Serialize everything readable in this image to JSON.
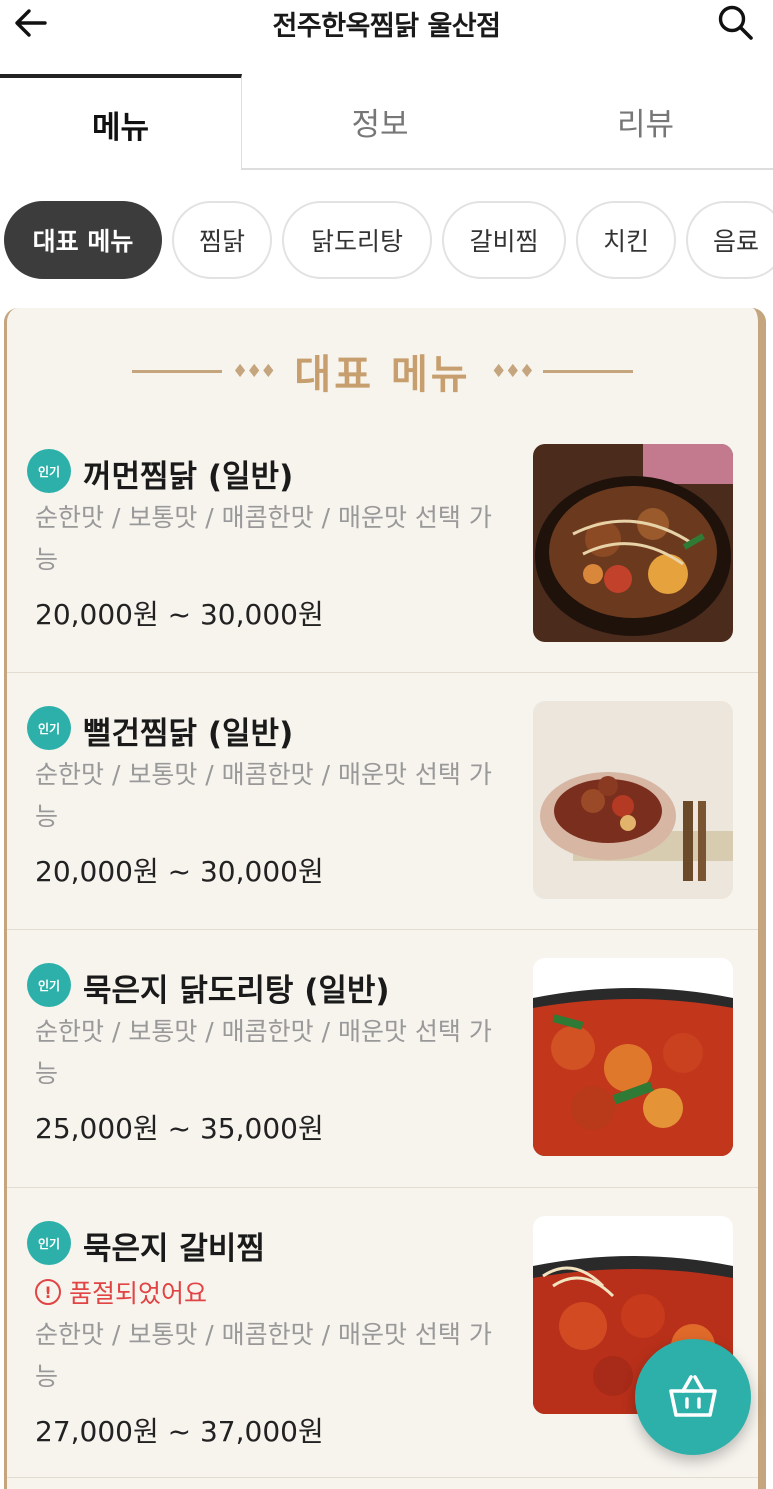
{
  "header": {
    "title": "전주한옥찜닭 울산점",
    "back_icon": "arrow-left-icon",
    "search_icon": "search-icon"
  },
  "tabs": [
    {
      "label": "메뉴",
      "active": true
    },
    {
      "label": "정보",
      "active": false
    },
    {
      "label": "리뷰",
      "active": false
    }
  ],
  "categories": [
    {
      "label": "대표 메뉴",
      "active": true
    },
    {
      "label": "찜닭",
      "active": false
    },
    {
      "label": "닭도리탕",
      "active": false
    },
    {
      "label": "갈비찜",
      "active": false
    },
    {
      "label": "치킨",
      "active": false
    },
    {
      "label": "음료",
      "active": false
    }
  ],
  "section": {
    "title": "대표 메뉴",
    "decoration": "♦♦♦"
  },
  "menu_items": [
    {
      "badge": "인기",
      "name": "꺼먼찜닭 (일반)",
      "soldout": "",
      "desc": "순한맛 / 보통맛 / 매콤한맛 / 매운맛 선택 가능",
      "price": "20,000원 ~ 30,000원"
    },
    {
      "badge": "인기",
      "name": "뻘건찜닭 (일반)",
      "soldout": "",
      "desc": "순한맛 / 보통맛 / 매콤한맛 / 매운맛 선택 가능",
      "price": "20,000원 ~ 30,000원"
    },
    {
      "badge": "인기",
      "name": "묵은지 닭도리탕 (일반)",
      "soldout": "",
      "desc": "순한맛 / 보통맛 / 매콤한맛 / 매운맛 선택 가능",
      "price": "25,000원 ~ 35,000원"
    },
    {
      "badge": "인기",
      "name": "묵은지 갈비찜",
      "soldout": "품절되었어요",
      "desc": "순한맛 / 보통맛 / 매콤한맛 / 매운맛 선택 가능",
      "price": "27,000원 ~ 37,000원"
    }
  ],
  "colors": {
    "accent": "#2db0aa",
    "gold": "#c4a57d",
    "soldout": "#e04444"
  },
  "cart_icon": "shopping-basket-icon"
}
